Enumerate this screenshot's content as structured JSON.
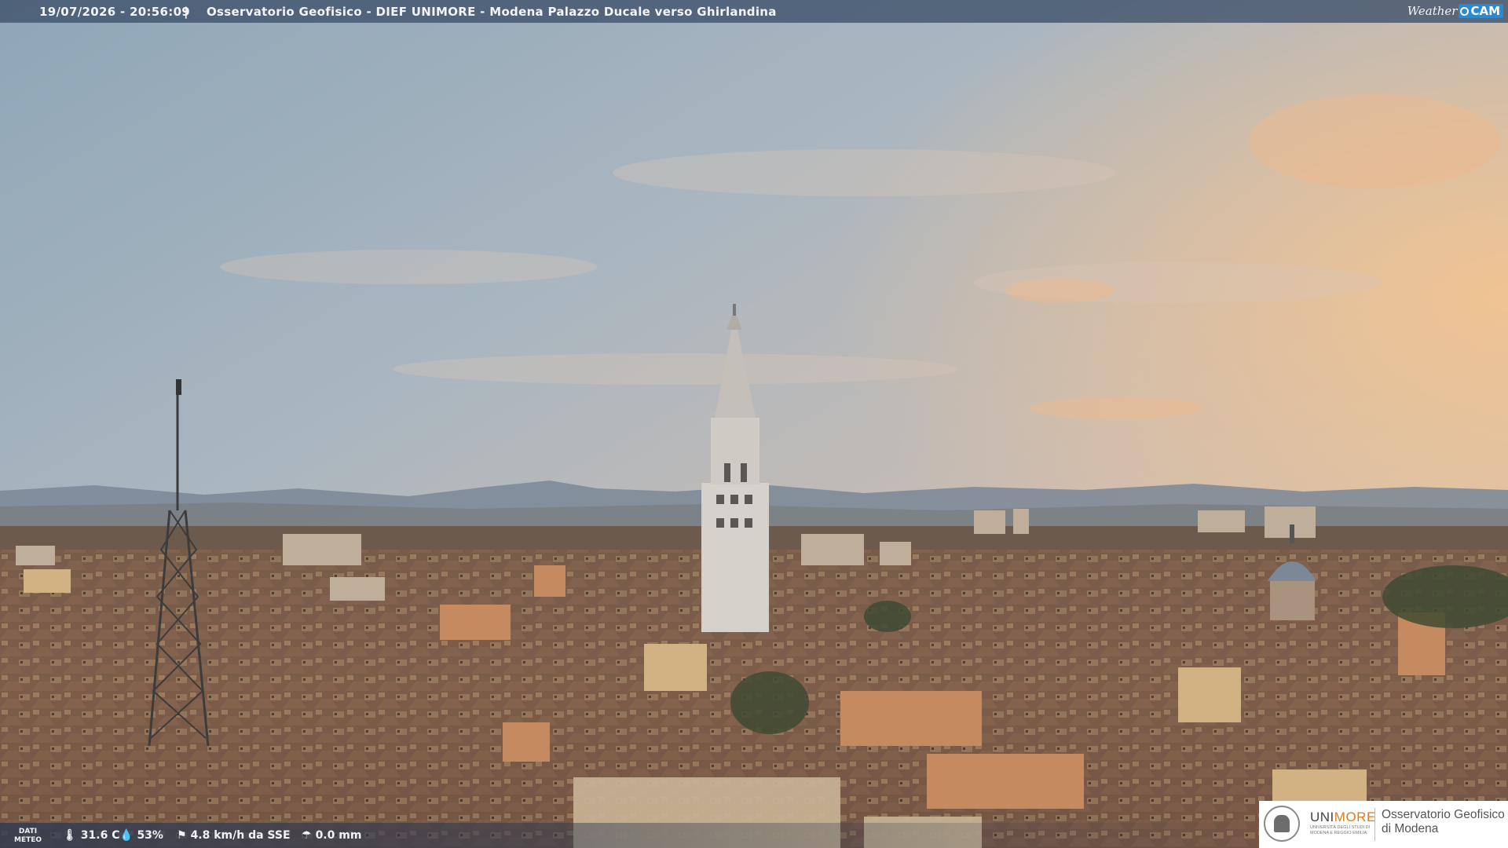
{
  "header": {
    "datetime": "19/07/2026 - 20:56:09",
    "separator": "|",
    "title": "Osservatorio Geofisico - DIEF UNIMORE - Modena Palazzo Ducale verso Ghirlandina",
    "logo_weather": "Weather",
    "logo_cam": "CAM"
  },
  "meteo": {
    "label_line1": "DATI",
    "label_line2": "METEO",
    "temperature": "31.6 C",
    "humidity": "53%",
    "wind": "4.8 km/h da SSE",
    "rain": "0.0 mm",
    "icons": [
      "thermometer-icon",
      "drop-icon",
      "wind-icon",
      "rain-icon"
    ]
  },
  "branding": {
    "brand_prefix": "UNI",
    "brand_suffix": "MORE",
    "brand_subtitle": "UNIVERSITÀ DEGLI STUDI DI MODENA E REGGIO EMILIA",
    "observatory_line1": "Osservatorio Geofisico",
    "observatory_line2": "di Modena"
  },
  "colors": {
    "accent_orange": "#e07a1f",
    "cam_blue": "#2c8ad0",
    "bar_blue": "#3c5069"
  }
}
